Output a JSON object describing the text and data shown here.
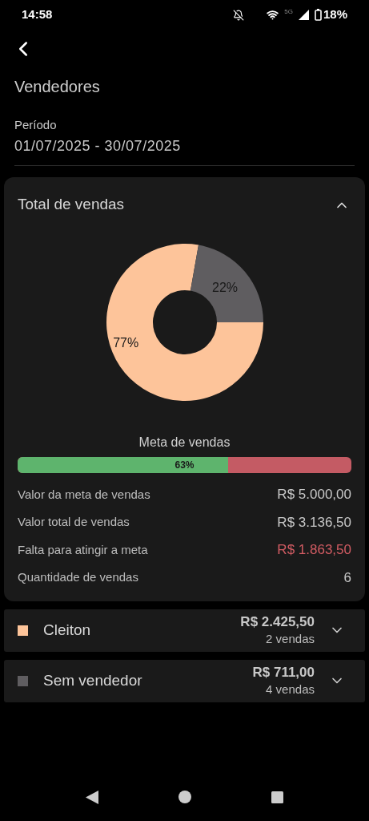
{
  "status_bar": {
    "time": "14:58",
    "network_label": "5G",
    "battery": "18%"
  },
  "header": {
    "title": "Vendedores",
    "period_label": "Período",
    "period_value": "01/07/2025 - 30/07/2025"
  },
  "summary_card": {
    "title": "Total de vendas",
    "expanded": true,
    "chart_data": {
      "type": "donut",
      "values": [
        77,
        22
      ],
      "value_labels": [
        "77%",
        "22%"
      ]
    },
    "goal": {
      "title": "Meta de vendas",
      "level": 0.63,
      "label": "63%"
    },
    "rows": [
      {
        "label": "Valor da meta de vendas",
        "value": "R$ 5.000,00",
        "kind": "normal"
      },
      {
        "label": "Valor total de vendas",
        "value": "R$ 3.136,50",
        "kind": "normal"
      },
      {
        "label": "Falta para atingir a meta",
        "value": "R$ 1.863,50",
        "kind": "alert"
      },
      {
        "label": "Quantidade de vendas",
        "value": "6",
        "kind": "normal"
      }
    ]
  },
  "sellers": [
    {
      "name": "Cleiton",
      "color": "#fdc49a",
      "total": "R$ 2.425,50",
      "count": "2 vendas",
      "expanded": false
    },
    {
      "name": "Sem vendedor",
      "color": "#5f5d60",
      "total": "R$ 711,00",
      "count": "4 vendas",
      "expanded": false
    }
  ]
}
